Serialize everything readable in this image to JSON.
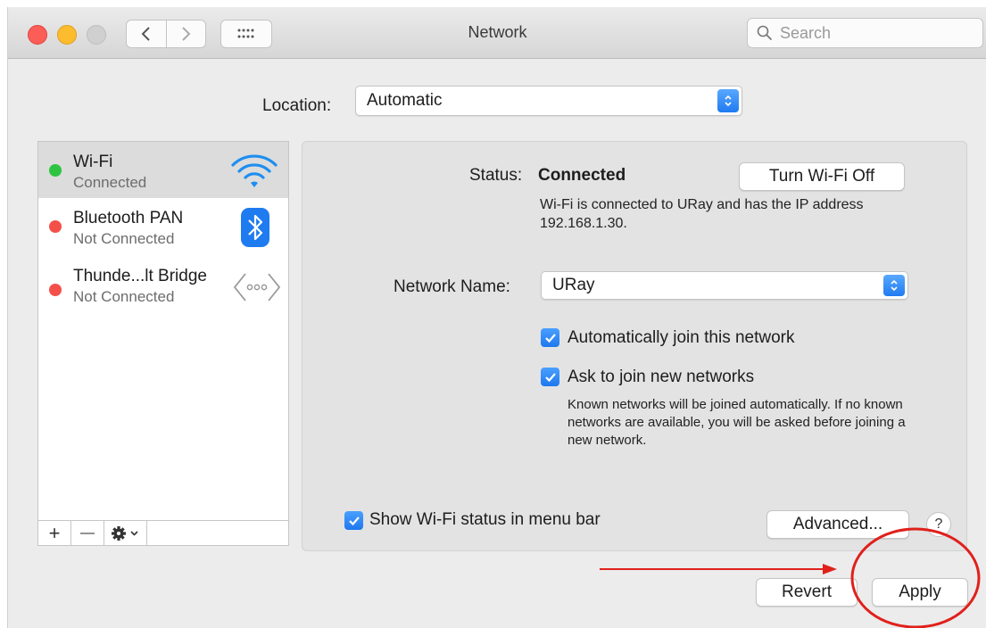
{
  "window": {
    "title": "Network",
    "search_placeholder": "Search"
  },
  "location": {
    "label": "Location:",
    "value": "Automatic"
  },
  "services": [
    {
      "name": "Wi-Fi",
      "status": "Connected",
      "status_color": "#2ec441",
      "icon": "wifi-icon"
    },
    {
      "name": "Bluetooth PAN",
      "status": "Not Connected",
      "status_color": "#f4504a",
      "icon": "bluetooth-icon"
    },
    {
      "name": "Thunde...lt Bridge",
      "status": "Not Connected",
      "status_color": "#f4504a",
      "icon": "thunderbolt-bridge-icon"
    }
  ],
  "sidebar_footer": {
    "add": "+",
    "remove": "—"
  },
  "detail": {
    "status_label": "Status:",
    "status_value": "Connected",
    "turn_off_button": "Turn Wi-Fi Off",
    "status_description": "Wi-Fi is connected to URay and has the IP address 192.168.1.30.",
    "network_name_label": "Network Name:",
    "network_name_value": "URay",
    "auto_join_label": "Automatically join this network",
    "ask_join_label": "Ask to join new networks",
    "ask_join_description": "Known networks will be joined automatically. If no known networks are available, you will be asked before joining a new network.",
    "show_status_label": "Show Wi-Fi status in menu bar",
    "advanced_button": "Advanced...",
    "help_button": "?"
  },
  "footer": {
    "revert_button": "Revert",
    "apply_button": "Apply"
  },
  "accent_color": "#1f7bf0",
  "annotation_color": "#e0201b"
}
